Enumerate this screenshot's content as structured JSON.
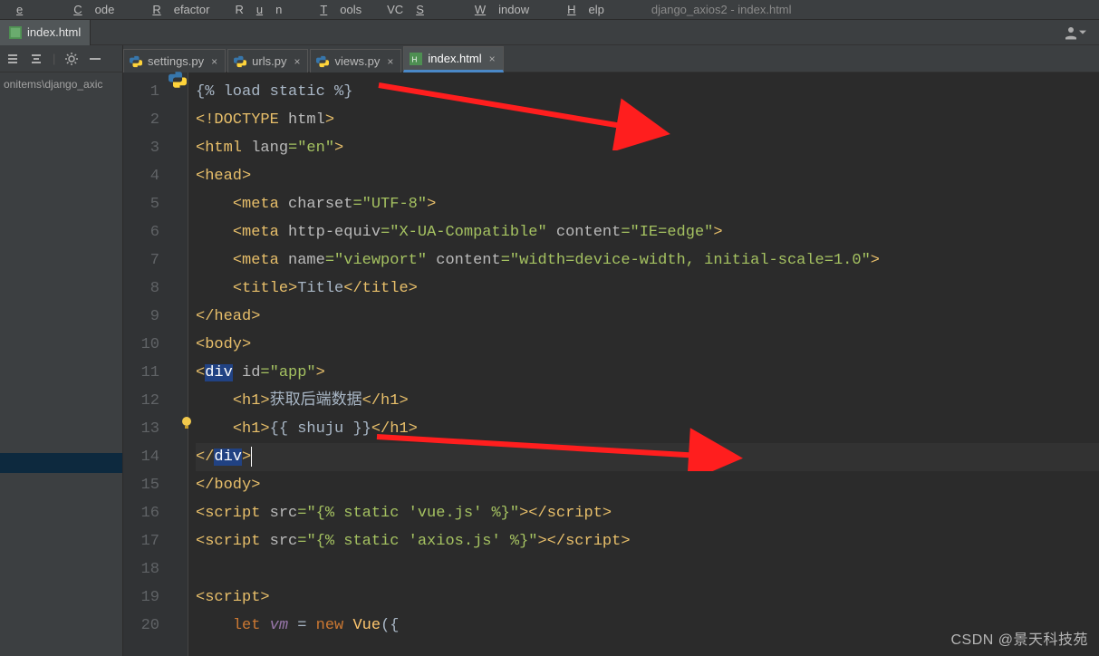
{
  "menu": {
    "items": [
      {
        "pre": "",
        "u": "e",
        "post": "",
        "full": "e"
      },
      {
        "pre": "",
        "u": "C",
        "post": "ode"
      },
      {
        "pre": "",
        "u": "R",
        "post": "efactor"
      },
      {
        "pre": "R",
        "u": "u",
        "post": "n"
      },
      {
        "pre": "",
        "u": "T",
        "post": "ools"
      },
      {
        "pre": "VC",
        "u": "S",
        "post": ""
      },
      {
        "pre": "",
        "u": "W",
        "post": "indow"
      },
      {
        "pre": "",
        "u": "H",
        "post": "elp"
      }
    ],
    "title": "django_axios2 - index.html"
  },
  "top_tab": "index.html",
  "project_path": "onitems\\django_axic",
  "file_tabs": [
    {
      "label": "settings.py",
      "icon": "py"
    },
    {
      "label": "urls.py",
      "icon": "py"
    },
    {
      "label": "views.py",
      "icon": "py"
    },
    {
      "label": "index.html",
      "icon": "html",
      "active": true
    }
  ],
  "line_numbers": [
    "1",
    "2",
    "3",
    "4",
    "5",
    "6",
    "7",
    "8",
    "9",
    "10",
    "11",
    "12",
    "13",
    "14",
    "15",
    "16",
    "17",
    "18",
    "19",
    "20"
  ],
  "code": {
    "l1": "{% load static %}",
    "l2_a": "<!DOCTYPE ",
    "l2_b": "html",
    "l2_c": ">",
    "l3_a": "<",
    "l3_b": "html ",
    "l3_c": "lang",
    "l3_d": "=",
    "l3_e": "\"en\"",
    "l3_f": ">",
    "l4": "head",
    "l5_tag": "meta",
    "l5_attr": "charset",
    "l5_val": "\"UTF-8\"",
    "l6_tag": "meta",
    "l6_a1": "http-equiv",
    "l6_v1": "\"X-UA-Compatible\"",
    "l6_a2": "content",
    "l6_v2": "\"IE=edge\"",
    "l7_tag": "meta",
    "l7_a1": "name",
    "l7_v1": "\"viewport\"",
    "l7_a2": "content",
    "l7_v2": "\"width=device-width, initial-scale=1.0\"",
    "l8_tag": "title",
    "l8_txt": "Title",
    "l9": "head",
    "l10": "body",
    "l11_tag": "div",
    "l11_attr": "id",
    "l11_val": "\"app\"",
    "l12_tag": "h1",
    "l12_txt": "获取后端数据",
    "l13_tag": "h1",
    "l13_txt": "{{ shuju }}",
    "l14": "div",
    "l15": "body",
    "l16_tag": "script",
    "l16_attr": "src",
    "l16_val": "\"{% static 'vue.js' %}\"",
    "l17_tag": "script",
    "l17_attr": "src",
    "l17_val": "\"{% static 'axios.js' %}\"",
    "l19": "script",
    "l20_let": "let ",
    "l20_var": "vm",
    "l20_eq": " = ",
    "l20_new": "new ",
    "l20_call": "Vue",
    "l20_paren": "({"
  },
  "watermark": "CSDN @景天科技苑"
}
